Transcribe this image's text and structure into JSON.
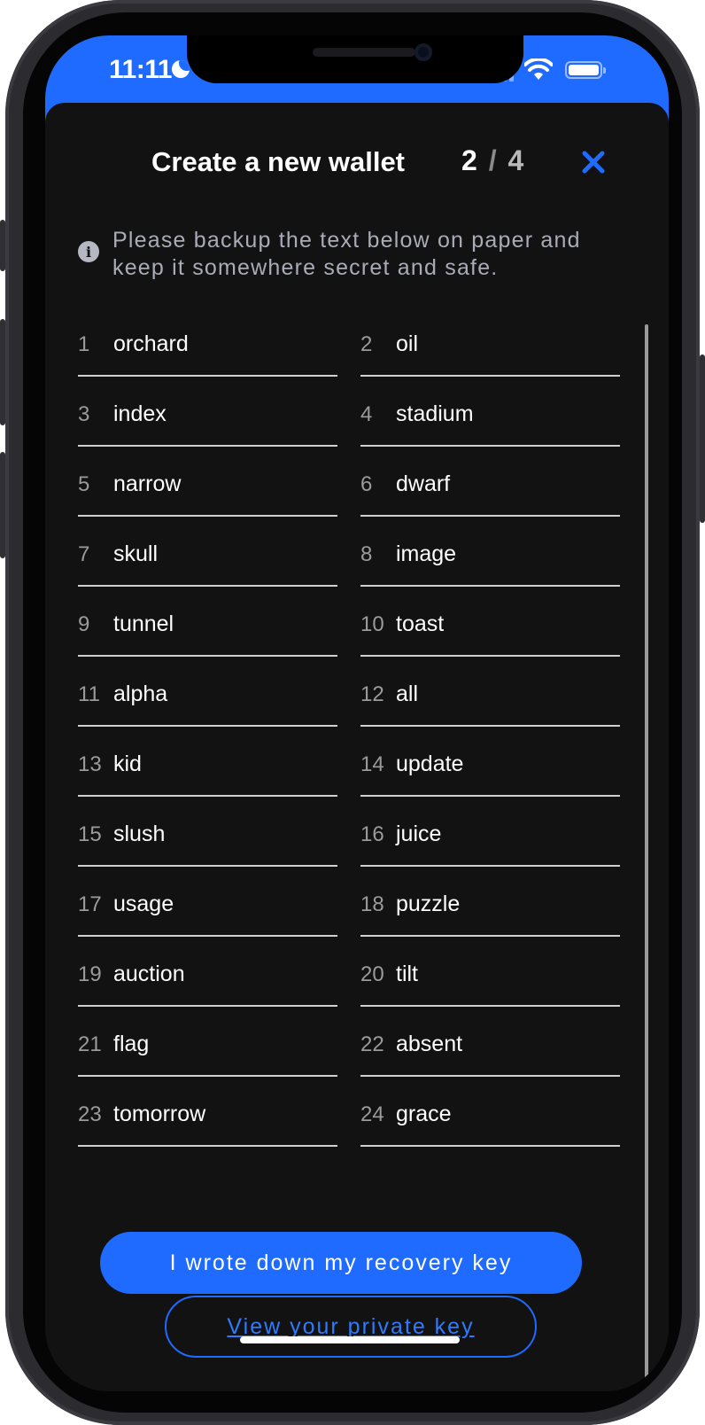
{
  "status_bar": {
    "time": "11:11",
    "icons": [
      "moon-icon",
      "signal-icon",
      "wifi-icon",
      "battery-icon"
    ]
  },
  "header": {
    "title": "Create a new wallet",
    "step_current": "2",
    "step_separator": "/",
    "step_total": "4",
    "close_icon": "close-icon"
  },
  "notice": {
    "icon": "info-icon",
    "text": "Please backup the text below on paper and keep it somewhere secret and safe."
  },
  "recovery_words": [
    {
      "index": "1",
      "word": "orchard"
    },
    {
      "index": "2",
      "word": "oil"
    },
    {
      "index": "3",
      "word": "index"
    },
    {
      "index": "4",
      "word": "stadium"
    },
    {
      "index": "5",
      "word": "narrow"
    },
    {
      "index": "6",
      "word": "dwarf"
    },
    {
      "index": "7",
      "word": "skull"
    },
    {
      "index": "8",
      "word": "image"
    },
    {
      "index": "9",
      "word": "tunnel"
    },
    {
      "index": "10",
      "word": "toast"
    },
    {
      "index": "11",
      "word": "alpha"
    },
    {
      "index": "12",
      "word": "all"
    },
    {
      "index": "13",
      "word": "kid"
    },
    {
      "index": "14",
      "word": "update"
    },
    {
      "index": "15",
      "word": "slush"
    },
    {
      "index": "16",
      "word": "juice"
    },
    {
      "index": "17",
      "word": "usage"
    },
    {
      "index": "18",
      "word": "puzzle"
    },
    {
      "index": "19",
      "word": "auction"
    },
    {
      "index": "20",
      "word": "tilt"
    },
    {
      "index": "21",
      "word": "flag"
    },
    {
      "index": "22",
      "word": "absent"
    },
    {
      "index": "23",
      "word": "tomorrow"
    },
    {
      "index": "24",
      "word": "grace"
    }
  ],
  "actions": {
    "primary_label": "I wrote down my recovery key",
    "secondary_label": "View your private key"
  },
  "colors": {
    "accent": "#1f6bff",
    "background": "#121212",
    "text": "#ffffff",
    "muted": "#a9acb6"
  }
}
